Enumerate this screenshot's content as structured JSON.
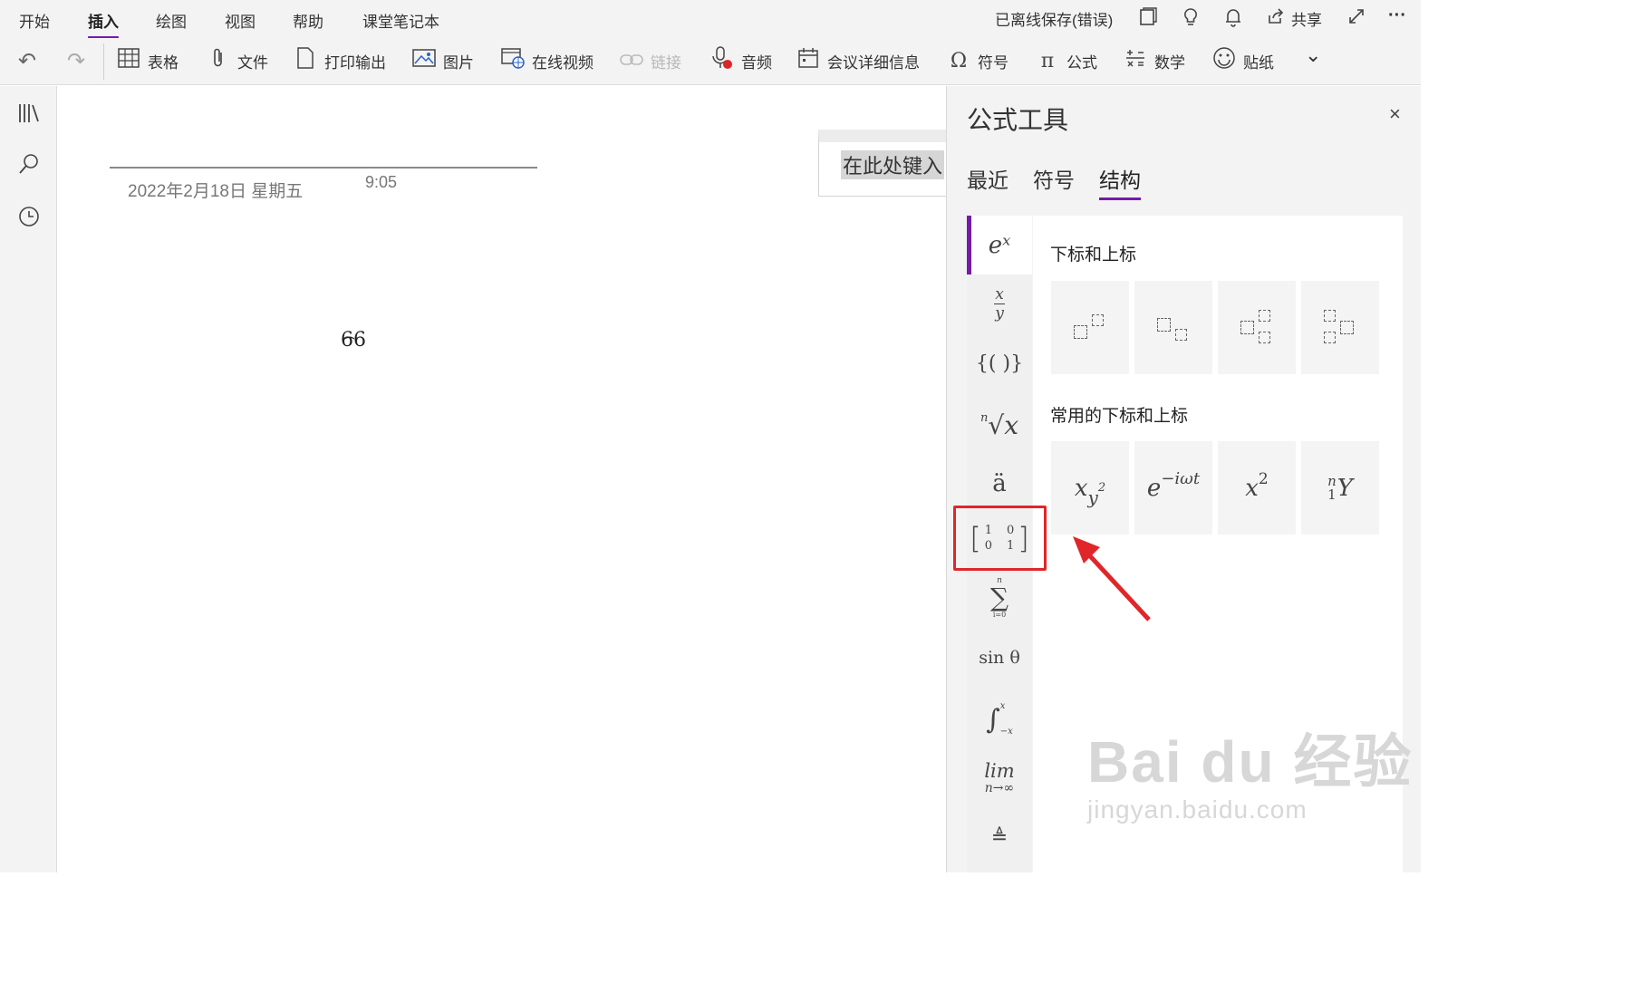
{
  "menu": {
    "tabs": [
      "开始",
      "插入",
      "绘图",
      "视图",
      "帮助",
      "课堂笔记本"
    ],
    "active_tab": "插入",
    "status": "已离线保存(错误)",
    "share_label": "共享",
    "more_glyph": "···"
  },
  "toolbar": {
    "undo_glyph": "↶",
    "redo_glyph": "↷",
    "table": "表格",
    "file": "文件",
    "printout": "打印输出",
    "picture": "图片",
    "online_video": "在线视频",
    "link": "链接",
    "audio": "音频",
    "meeting_details": "会议详细信息",
    "symbol": "符号",
    "equation": "公式",
    "math": "数学",
    "sticker": "贴纸",
    "overflow_glyph": "⌄"
  },
  "page": {
    "date": "2022年2月18日 星期五",
    "time": "9:05",
    "math_expr": "66",
    "math_arc": "⌢",
    "equation_placeholder": "在此处键入"
  },
  "panel": {
    "title": "公式工具",
    "close_glyph": "×",
    "tabs": [
      "最近",
      "符号",
      "结构"
    ],
    "active_tab": "结构",
    "categories": {
      "power": "eˣ",
      "fraction_num": "x",
      "fraction_den": "y",
      "brackets": "{( )}",
      "root_index": "n",
      "root": "√x",
      "accent": "ä",
      "matrix_tl": "1",
      "matrix_tr": "0",
      "matrix_bl": "0",
      "matrix_br": "1",
      "sum_top": "n",
      "sum": "∑",
      "sum_bottom": "i=0",
      "function": "sin θ",
      "integral": "∫",
      "integral_top": "x",
      "integral_bottom": "−x",
      "limit": "lim",
      "limit_sub": "n→∞",
      "operator": "≜"
    },
    "section1": "下标和上标",
    "section2": "常用的下标和上标",
    "common": {
      "t1_base": "x",
      "t1_sub": "y",
      "t1_sup": "2",
      "t2_base": "e",
      "t2_sup": "−iωt",
      "t3_base": "x",
      "t3_sup": "2",
      "t4_pre_sup": "n",
      "t4_pre_sub": "1",
      "t4_base": "Y"
    }
  },
  "watermark": {
    "line1": "Bai du 经验",
    "line2": "jingyan.baidu.com"
  },
  "accent_color": "#7719aa",
  "highlight_color": "#e0262b"
}
